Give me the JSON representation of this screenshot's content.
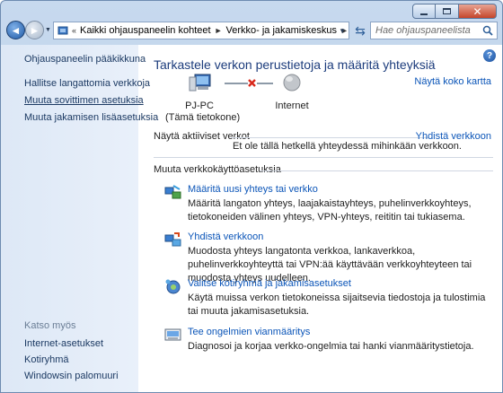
{
  "window": {
    "minimize_icon": "minimize-icon",
    "maximize_icon": "maximize-icon",
    "close_icon": "close-icon"
  },
  "navbar": {
    "breadcrumb": [
      "Kaikki ohjauspaneelin kohteet",
      "Verkko- ja jakamiskeskus"
    ],
    "search_placeholder": "Hae ohjauspaneelista"
  },
  "sidebar": {
    "home": "Ohjauspaneelin pääkikkuna",
    "items": [
      "Hallitse langattomia verkkoja",
      "Muuta sovittimen asetuksia",
      "Muuta jakamisen lisäasetuksia"
    ],
    "see_also_heading": "Katso myös",
    "see_also": [
      "Internet-asetukset",
      "Kotiryhmä",
      "Windowsin palomuuri"
    ]
  },
  "main": {
    "title": "Tarkastele verkon perustietoja ja määritä yhteyksiä",
    "view_full_map": "Näytä koko kartta",
    "map": {
      "computer_name": "PJ-PC",
      "computer_sub": "(Tämä tietokone)",
      "internet": "Internet"
    },
    "active_networks": {
      "heading": "Näytä aktiiviset verkot",
      "connect_link": "Yhdistä verkkoon",
      "status": "Et ole tällä hetkellä yhteydessä mihinkään verkkoon."
    },
    "settings": {
      "heading": "Muuta verkkokäyttöasetuksia",
      "tasks": [
        {
          "title": "Määritä uusi yhteys tai verkko",
          "desc": "Määritä langaton yhteys, laajakaistayhteys, puhelinverkkoyhteys, tietokoneiden välinen yhteys, VPN-yhteys, reititin tai tukiasema.",
          "icon": "new-connection-icon"
        },
        {
          "title": "Yhdistä verkkoon",
          "desc": "Muodosta yhteys langatonta verkkoa, lankaverkkoa, puhelinverkkoyhteyttä tai VPN:ää käyttävään verkkoyhteyteen tai muodosta yhteys uudelleen.",
          "icon": "connect-network-icon"
        },
        {
          "title": "Valitse kotiryhmä ja jakamisasetukset",
          "desc": "Käytä muissa verkon tietokoneissa sijaitsevia tiedostoja ja tulostimia tai muuta jakamisasetuksia.",
          "icon": "homegroup-icon"
        },
        {
          "title": "Tee ongelmien vianmääritys",
          "desc": "Diagnosoi ja korjaa verkko-ongelmia tai hanki vianmääritystietoja.",
          "icon": "troubleshoot-icon"
        }
      ]
    }
  }
}
